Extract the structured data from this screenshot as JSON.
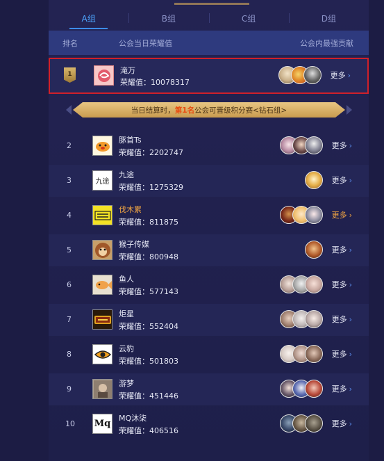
{
  "tabs": [
    {
      "label": "A组",
      "active": true
    },
    {
      "label": "B组",
      "active": false
    },
    {
      "label": "C组",
      "active": false
    },
    {
      "label": "D组",
      "active": false
    }
  ],
  "header": {
    "rank": "排名",
    "score": "公会当日荣耀值",
    "contributor": "公会内最强贡献"
  },
  "banner": {
    "prefix": "当日结算时，",
    "highlight": "第1名",
    "suffix": "公会可晋级积分赛<钻石组>"
  },
  "more_label": "更多",
  "rows": [
    {
      "rank": "1",
      "name": "滝万",
      "score": "荣耀值：10078317",
      "logo": "pink-swirl-logo",
      "highlight": false
    },
    {
      "rank": "2",
      "name": "豚首Ts",
      "score": "荣耀值：2202747",
      "logo": "pig-logo",
      "highlight": false
    },
    {
      "rank": "3",
      "name": "九途",
      "score": "荣耀值：1275329",
      "logo_text": "九途",
      "highlight": false
    },
    {
      "rank": "4",
      "name": "伐木累",
      "score": "荣耀值：811875",
      "logo": "yellow-logo",
      "highlight": true
    },
    {
      "rank": "5",
      "name": "猴子传媒",
      "score": "荣耀值：800948",
      "logo": "monkey-logo",
      "highlight": false
    },
    {
      "rank": "6",
      "name": "鱼人",
      "score": "荣耀值：577143",
      "logo": "fish-logo",
      "highlight": false
    },
    {
      "rank": "7",
      "name": "炬星",
      "score": "荣耀值：552404",
      "logo": "star-logo",
      "highlight": false
    },
    {
      "rank": "8",
      "name": "云豹",
      "score": "荣耀值：501803",
      "logo": "leopard-eye-logo",
      "highlight": false
    },
    {
      "rank": "9",
      "name": "游梦",
      "score": "荣耀值：451446",
      "logo": "dream-logo",
      "highlight": false
    },
    {
      "rank": "10",
      "name": "MQ沐柒",
      "score": "荣耀值：406516",
      "logo_text": "Mq",
      "highlight": false
    }
  ],
  "colors": {
    "active_tab": "#4ea6ff",
    "highlight_text": "#f0a442",
    "first_row_border": "#d0202a",
    "banner_gold": "#e0ba72"
  }
}
